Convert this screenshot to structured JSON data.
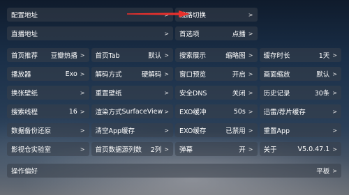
{
  "top": [
    [
      {
        "label": "配置地址",
        "value": "",
        "w": 2
      },
      {
        "label": "线路切换",
        "value": "",
        "w": 1
      }
    ],
    [
      {
        "label": "直播地址",
        "value": "",
        "w": 2
      },
      {
        "label": "首选项",
        "value": "点播",
        "w": 1
      }
    ]
  ],
  "rows": [
    [
      {
        "label": "首页推荐",
        "value": "豆瓣热播"
      },
      {
        "label": "首页Tab",
        "value": "默认"
      },
      {
        "label": "搜索展示",
        "value": "缩略图"
      },
      {
        "label": "缓存时长",
        "value": "1天"
      }
    ],
    [
      {
        "label": "播放器",
        "value": "Exo"
      },
      {
        "label": "解码方式",
        "value": "硬解码"
      },
      {
        "label": "窗口预览",
        "value": "开启"
      },
      {
        "label": "画面缩放",
        "value": "默认"
      }
    ],
    [
      {
        "label": "换张壁纸",
        "value": ""
      },
      {
        "label": "重置壁纸",
        "value": ""
      },
      {
        "label": "安全DNS",
        "value": "关闭"
      },
      {
        "label": "历史记录",
        "value": "30条"
      }
    ],
    [
      {
        "label": "搜索线程",
        "value": "16"
      },
      {
        "label": "渲染方式",
        "value": "SurfaceView"
      },
      {
        "label": "EXO缓冲",
        "value": "50s"
      },
      {
        "label": "迅雷/荐片缓存",
        "value": ""
      }
    ],
    [
      {
        "label": "数据备份还原",
        "value": ""
      },
      {
        "label": "清空App缓存",
        "value": ""
      },
      {
        "label": "EXO缓存",
        "value": "已禁用"
      },
      {
        "label": "重置App",
        "value": ""
      }
    ],
    [
      {
        "label": "影视仓实验室",
        "value": ""
      },
      {
        "label": "首页数据源列数",
        "value": "2列"
      },
      {
        "label": "弹幕",
        "value": "开"
      },
      {
        "label": "关于",
        "value": "V5.0.47.1"
      }
    ]
  ],
  "bottom": {
    "label": "操作偏好",
    "value": "平板"
  },
  "chevron": ">",
  "colors": {
    "arrow": "#e8302c",
    "cell_bg": "#38404a",
    "text": "#ffffff"
  },
  "icons": {
    "arrow": "red-arrow-annotation"
  }
}
